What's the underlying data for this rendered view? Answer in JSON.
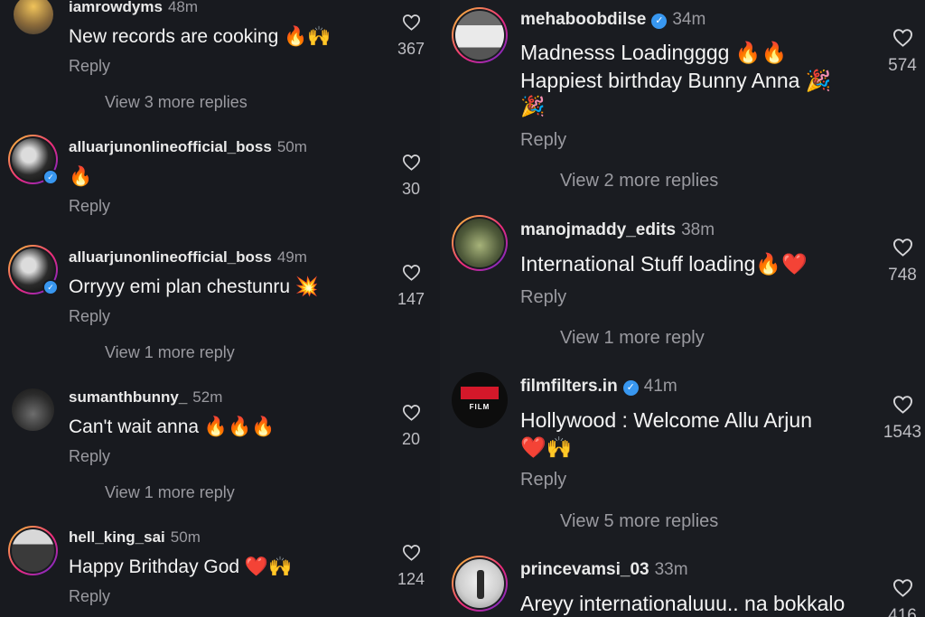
{
  "left": [
    {
      "username": "iamrowdyms",
      "time": "48m",
      "text": "New records are cooking 🔥🙌",
      "reply": "Reply",
      "likes": "367",
      "more": "View 3 more replies"
    },
    {
      "username": "alluarjunonlineofficial_boss",
      "time": "50m",
      "text": "🔥",
      "reply": "Reply",
      "likes": "30",
      "more": ""
    },
    {
      "username": "alluarjunonlineofficial_boss",
      "time": "49m",
      "text": "Orryyy emi plan chestunru 💥",
      "reply": "Reply",
      "likes": "147",
      "more": "View 1 more reply"
    },
    {
      "username": "sumanthbunny_",
      "time": "52m",
      "text": "Can't wait anna 🔥🔥🔥",
      "reply": "Reply",
      "likes": "20",
      "more": "View 1 more reply"
    },
    {
      "username": "hell_king_sai",
      "time": "50m",
      "text": "Happy Brithday God ❤️🙌",
      "reply": "Reply",
      "likes": "124",
      "more": ""
    }
  ],
  "right": [
    {
      "username": "mehaboobdilse",
      "verified": true,
      "time": "34m",
      "text_line1": "Madnesss Loadingggg 🔥🔥",
      "text_line2": "Happiest birthday Bunny Anna 🎉",
      "text_line3": "🎉",
      "reply": "Reply",
      "likes": "574",
      "more": "View 2 more replies"
    },
    {
      "username": "manojmaddy_edits",
      "time": "38m",
      "text_line1": "International Stuff loading🔥❤️",
      "reply": "Reply",
      "likes": "748",
      "more": "View 1 more reply"
    },
    {
      "username": "filmfilters.in",
      "verified": true,
      "time": "41m",
      "text_line1": "Hollywood : Welcome Allu Arjun",
      "text_line2": "❤️🙌",
      "reply": "Reply",
      "likes": "1543",
      "more": "View 5 more replies",
      "avatar_text": "FILM"
    },
    {
      "username": "princevamsi_03",
      "time": "33m",
      "text_line1": "Areyy internationaluuu.. na bokkalo",
      "likes": "416"
    }
  ],
  "icons": {
    "like": "heart-outline-icon",
    "verified": "verified-badge-icon"
  },
  "colors": {
    "background": "#181a1f",
    "muted": "#9a9aa0",
    "verified": "#3897f0"
  }
}
